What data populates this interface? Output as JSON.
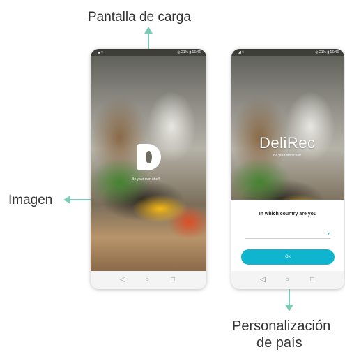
{
  "annotations": {
    "loading_screen": "Pantalla de carga",
    "image": "Imagen",
    "country_customization_line1": "Personalización",
    "country_customization_line2": "de país"
  },
  "colors": {
    "arrow": "#7ccbb6",
    "ok_button": "#0fb5cf"
  },
  "screen_left": {
    "status_left": "◢ ≈",
    "status_right": "◎ 21% ▮ 16:46",
    "tagline": "Be your own chef!",
    "logo_icon": "delirec-d-logo-icon"
  },
  "screen_right": {
    "status_left": "◢ ≈",
    "status_right": "◎ 21% ▮ 16:46",
    "brand": "DeliRec",
    "tagline": "Be your own chef!",
    "question": "In which country are you",
    "ok_label": "Ok"
  },
  "nav": {
    "back": "◁",
    "home": "○",
    "recents": "□"
  }
}
